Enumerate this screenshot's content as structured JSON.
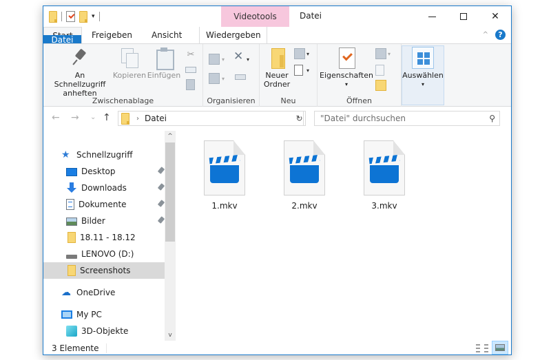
{
  "window": {
    "title": "Datei",
    "context_tab_group": "Videotools",
    "controls": {
      "minimize": "minimize",
      "maximize": "maximize",
      "close": "✕"
    }
  },
  "quick_access_toolbar": {
    "items": [
      "folder-icon",
      "properties-icon",
      "new-folder-icon"
    ],
    "dropdown": "▾"
  },
  "ribbon": {
    "tabs": [
      {
        "label": "Datei",
        "type": "file"
      },
      {
        "label": "Start",
        "active": true
      },
      {
        "label": "Freigeben"
      },
      {
        "label": "Ansicht"
      },
      {
        "label": "Wiedergeben",
        "context": true
      }
    ],
    "collapse_icon": "^",
    "help_icon": "?",
    "groups": {
      "clipboard": {
        "label": "Zwischenablage",
        "pin": "An Schnellzugriff",
        "pin_line2": "anheften",
        "copy": "Kopieren",
        "paste": "Einfügen"
      },
      "organize": {
        "label": "Organisieren"
      },
      "new": {
        "label": "Neu",
        "new_folder": "Neuer",
        "new_folder_line2": "Ordner"
      },
      "open": {
        "label": "Öffnen",
        "properties": "Eigenschaften"
      },
      "select": {
        "label": "Auswählen"
      }
    }
  },
  "navigation": {
    "back": "←",
    "forward": "→",
    "recent": "⌄",
    "up": "↑",
    "address": {
      "crumb_sep": "›",
      "crumb": "Datei",
      "dropdown": "⌄"
    },
    "refresh": "↻",
    "search": {
      "placeholder": "\"Datei\" durchsuchen",
      "icon": "⚲"
    }
  },
  "nav_pane": {
    "items": [
      {
        "label": "Schnellzugriff",
        "icon": "quick-access-star-icon"
      },
      {
        "label": "Desktop",
        "icon": "desktop-icon",
        "pinned": true
      },
      {
        "label": "Downloads",
        "icon": "downloads-icon",
        "pinned": true
      },
      {
        "label": "Dokumente",
        "icon": "documents-icon",
        "pinned": true
      },
      {
        "label": "Bilder",
        "icon": "pictures-icon",
        "pinned": true
      },
      {
        "label": "18.11 - 18.12",
        "icon": "folder-icon"
      },
      {
        "label": "LENOVO (D:)",
        "icon": "drive-icon"
      },
      {
        "label": "Screenshots",
        "icon": "folder-icon",
        "selected": true
      },
      {
        "label": "OneDrive",
        "icon": "onedrive-icon"
      },
      {
        "label": "My PC",
        "icon": "pc-icon"
      },
      {
        "label": "3D-Objekte",
        "icon": "3d-objects-icon"
      }
    ],
    "scroll_up": "^",
    "scroll_down": "v"
  },
  "files": [
    {
      "name": "1.mkv",
      "icon": "video-file-icon"
    },
    {
      "name": "2.mkv",
      "icon": "video-file-icon"
    },
    {
      "name": "3.mkv",
      "icon": "video-file-icon"
    }
  ],
  "status_bar": {
    "count": "3 Elemente",
    "views": [
      "details-view",
      "large-icons-view"
    ],
    "active_view": "large-icons-view"
  },
  "colors": {
    "accent": "#1979ca",
    "context_tab": "#f7c7dd",
    "selection": "#d9d9d9",
    "video_icon": "#0d74d4"
  }
}
